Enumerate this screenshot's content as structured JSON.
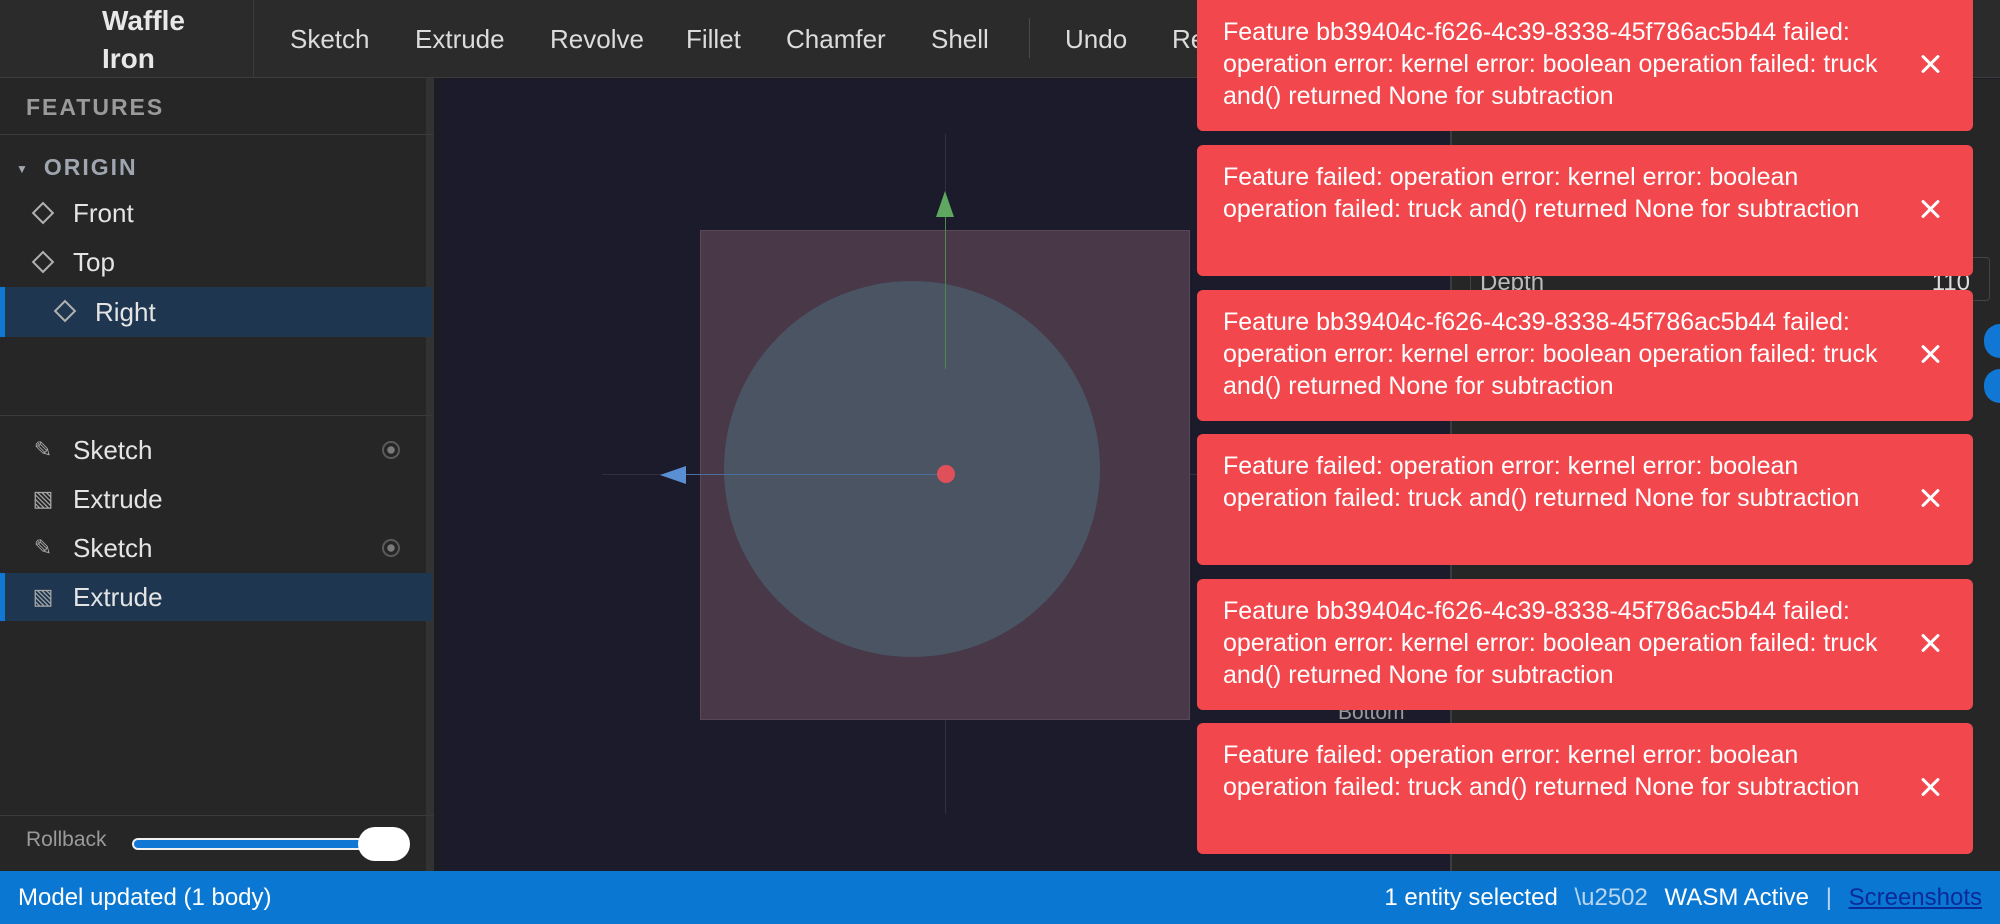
{
  "app": {
    "title_line1": "Waffle",
    "title_line2": "Iron"
  },
  "toolbar": {
    "items": [
      "Sketch",
      "Extrude",
      "Revolve",
      "Fillet",
      "Chamfer",
      "Shell"
    ],
    "undo_label": "Undo",
    "redo_label": "Re"
  },
  "sidebar": {
    "title": "FEATURES",
    "origin_label": "ORIGIN",
    "origin_items": [
      {
        "label": "Front",
        "icon": "plane-icon"
      },
      {
        "label": "Top",
        "icon": "plane-icon"
      },
      {
        "label": "Right",
        "icon": "plane-icon",
        "selected": true
      }
    ],
    "features": [
      {
        "label": "Sketch",
        "icon": "pencil-icon",
        "has_visibility": true
      },
      {
        "label": "Extrude",
        "icon": "extrude-icon"
      },
      {
        "label": "Sketch",
        "icon": "pencil-icon",
        "has_visibility": true
      },
      {
        "label": "Extrude",
        "icon": "extrude-icon",
        "selected": true
      }
    ],
    "rollback_label": "Rollback",
    "rollback_value": 1.0
  },
  "properties": {
    "depth_label": "Depth",
    "depth_value": "110",
    "bottom_label": "Bottom"
  },
  "toasts": [
    {
      "message": "Feature bb39404c-f626-4c39-8338-45f786ac5b44 failed: operation error: kernel error: boolean operation failed: truck and() returned None for subtraction"
    },
    {
      "message": "Feature failed: operation error: kernel error: boolean operation failed: truck and() returned None for subtraction"
    },
    {
      "message": "Feature bb39404c-f626-4c39-8338-45f786ac5b44 failed: operation error: kernel error: boolean operation failed: truck and() returned None for subtraction"
    },
    {
      "message": "Feature failed: operation error: kernel error: boolean operation failed: truck and() returned None for subtraction"
    },
    {
      "message": "Feature bb39404c-f626-4c39-8338-45f786ac5b44 failed: operation error: kernel error: boolean operation failed: truck and() returned None for subtraction"
    },
    {
      "message": "Feature failed: operation error: kernel error: boolean operation failed: truck and() returned None for subtraction"
    }
  ],
  "status": {
    "left": "Model updated (1 body)",
    "selection": "1 entity selected",
    "sep1": "\\u2502",
    "wasm": "WASM Active",
    "sep2": "|",
    "link": "Screenshots"
  },
  "colors": {
    "accent": "#1177d4",
    "toast_error": "#f2474d",
    "statusbar": "#0a78d2"
  }
}
